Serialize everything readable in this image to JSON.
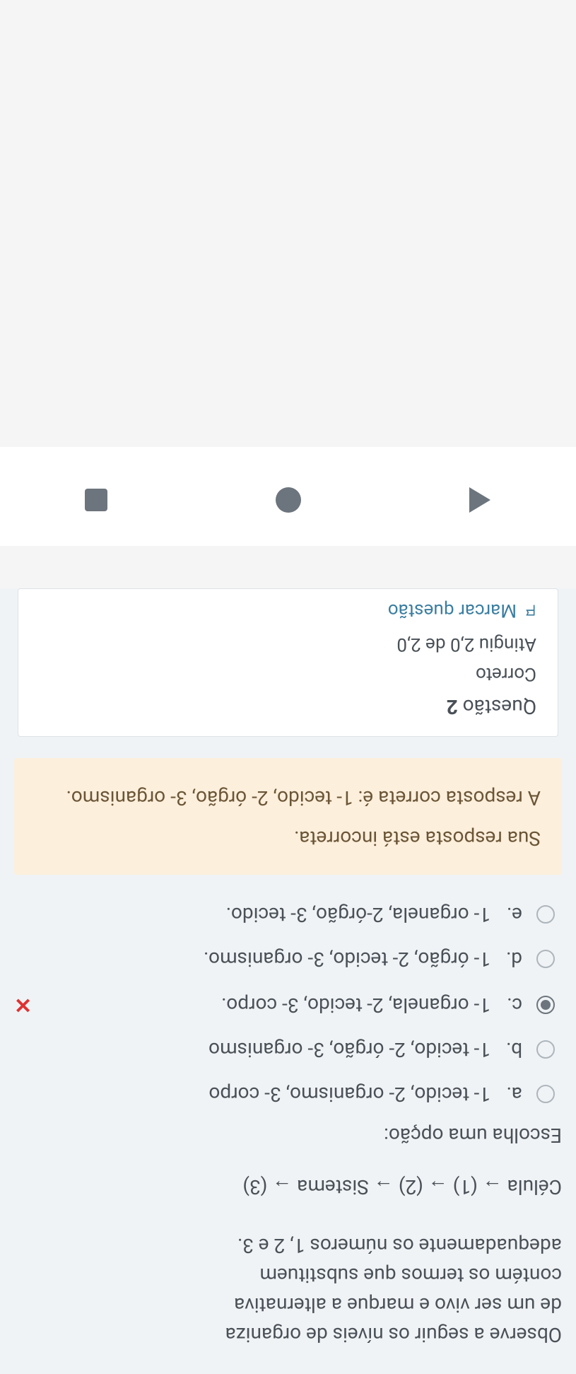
{
  "question": {
    "text_line1": "Observe a seguir os níveis de organiza",
    "text_line2": "de um ser vivo e marque a alternativa",
    "text_line3": "contém os termos que substituem",
    "text_line4": "adequadamente os números 1, 2 e 3.",
    "sequence": "Célula → (1) → (2) → Sistema → (3)",
    "prompt": "Escolha uma opção:"
  },
  "options": {
    "a": {
      "letter": "a.",
      "text": "1- tecido, 2- organismo, 3- corpo"
    },
    "b": {
      "letter": "b.",
      "text": "1- tecido, 2- órgão, 3- organismo"
    },
    "c": {
      "letter": "c.",
      "text": "1- organela, 2- tecido, 3- corpo."
    },
    "d": {
      "letter": "d.",
      "text": "1- órgão, 2- tecido, 3- organismo."
    },
    "e": {
      "letter": "e.",
      "text": "1- organela, 2-órgão, 3- tecido."
    }
  },
  "wrong_mark": "✕",
  "feedback": {
    "title": "Sua resposta está incorreta.",
    "answer": "A resposta correta é: 1- tecido, 2- órgão, 3- organismo."
  },
  "question_card": {
    "title_prefix": "Questão ",
    "number": "2",
    "status": "Correto",
    "score": "Atingiu 2,0 de 2,0",
    "flag_label": "Marcar questão"
  }
}
